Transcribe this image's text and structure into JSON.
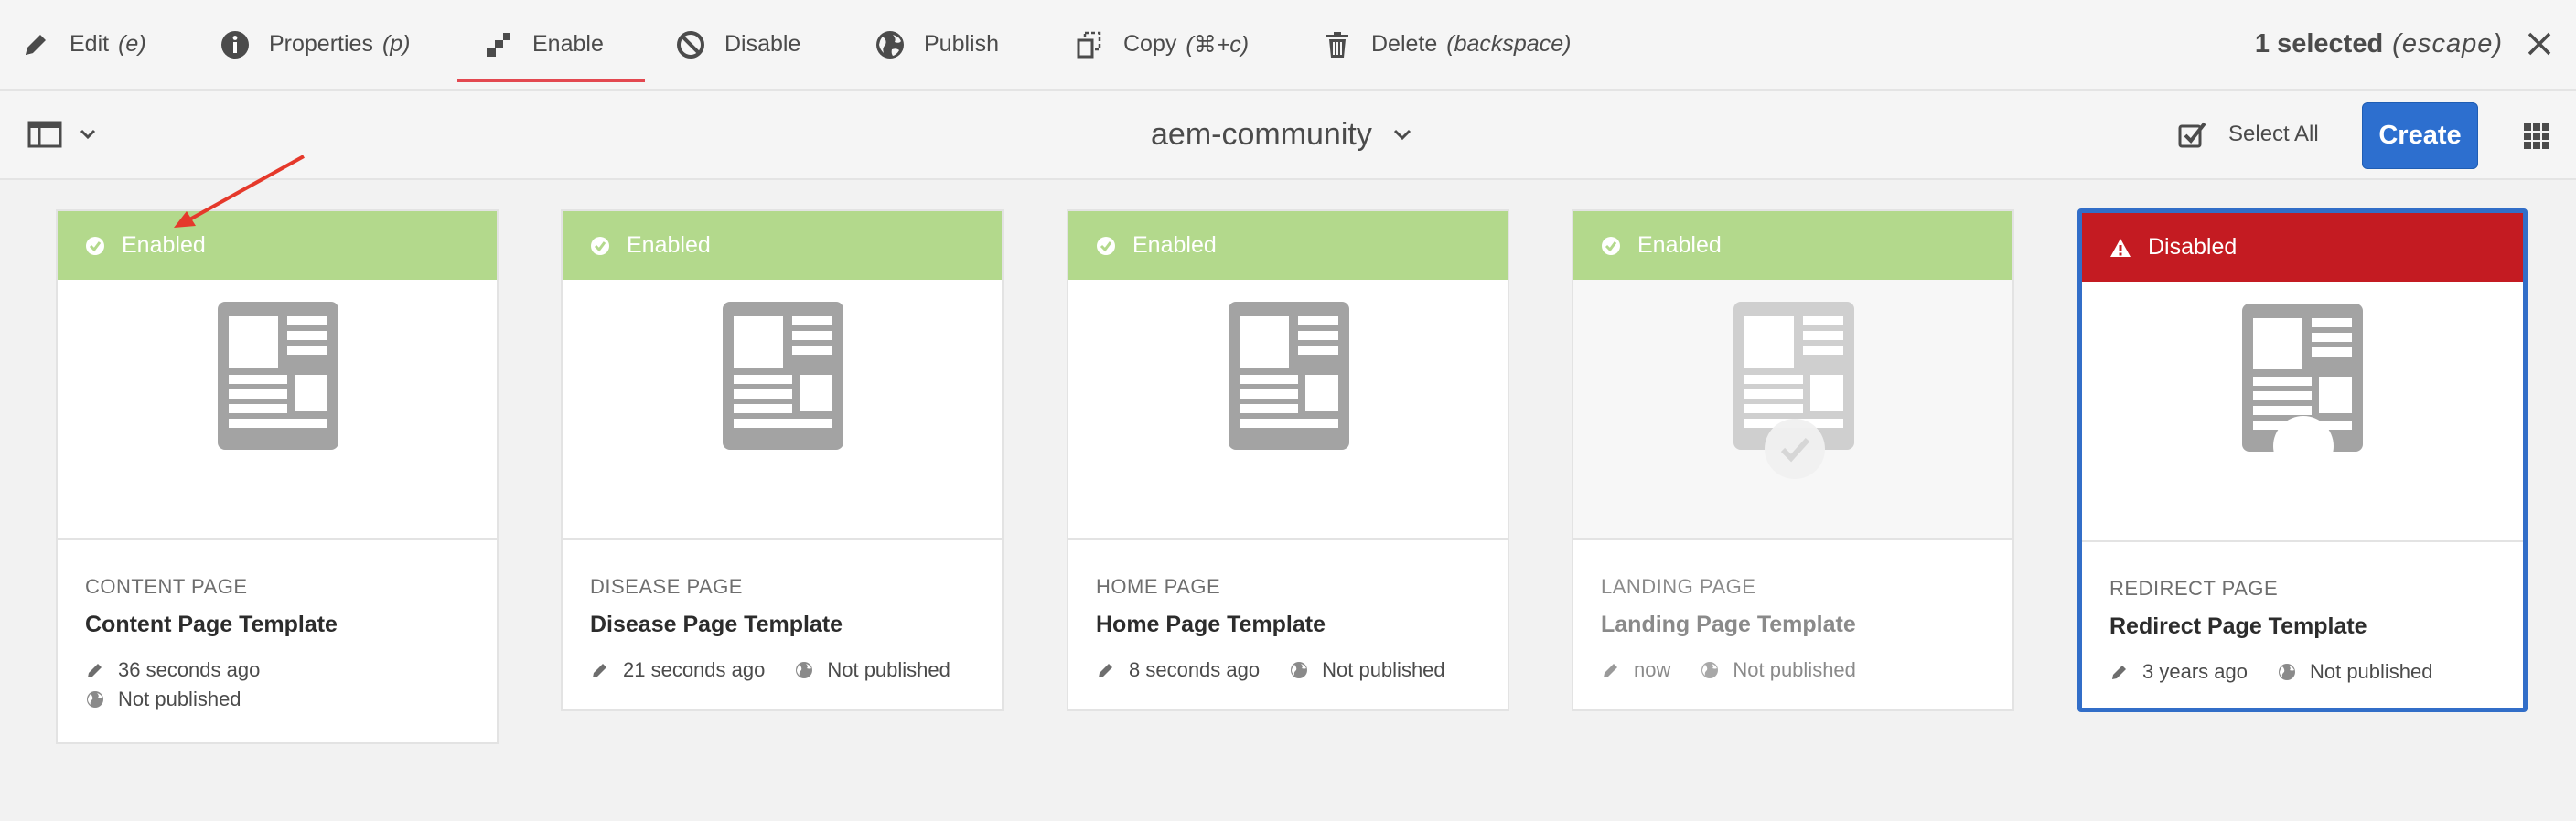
{
  "actions": [
    {
      "label": "Edit",
      "shortcut": "(e)",
      "icon": "pencil-icon"
    },
    {
      "label": "Properties",
      "shortcut": "(p)",
      "icon": "info-icon"
    },
    {
      "label": "Enable",
      "shortcut": "",
      "icon": "enable-icon"
    },
    {
      "label": "Disable",
      "shortcut": "",
      "icon": "prohibit-icon"
    },
    {
      "label": "Publish",
      "shortcut": "",
      "icon": "globe-icon"
    },
    {
      "label": "Copy",
      "shortcut": "(⌘+c)",
      "icon": "copy-icon"
    },
    {
      "label": "Delete",
      "shortcut": "(backspace)",
      "icon": "trash-icon"
    }
  ],
  "selection": {
    "count": "1 selected",
    "escape": "(escape)"
  },
  "toolbar": {
    "title": "aem-community",
    "select_all": "Select All",
    "create": "Create"
  },
  "colors": {
    "accent": "#2d6fcf",
    "enabled": "#b3d98c",
    "disabled": "#c41b22",
    "active_tab": "#e34850",
    "selected_border": "#326ec8"
  },
  "cards": [
    {
      "status": "Enabled",
      "type": "CONTENT PAGE",
      "title": "Content Page Template",
      "modified": "36 seconds ago",
      "published": "Not published"
    },
    {
      "status": "Enabled",
      "type": "DISEASE PAGE",
      "title": "Disease Page Template",
      "modified": "21 seconds ago",
      "published": "Not published"
    },
    {
      "status": "Enabled",
      "type": "HOME PAGE",
      "title": "Home Page Template",
      "modified": "8 seconds ago",
      "published": "Not published"
    },
    {
      "status": "Enabled",
      "type": "LANDING PAGE",
      "title": "Landing Page Template",
      "modified": "now",
      "published": "Not published"
    },
    {
      "status": "Disabled",
      "type": "REDIRECT PAGE",
      "title": "Redirect Page Template",
      "modified": "3 years ago",
      "published": "Not published"
    }
  ]
}
